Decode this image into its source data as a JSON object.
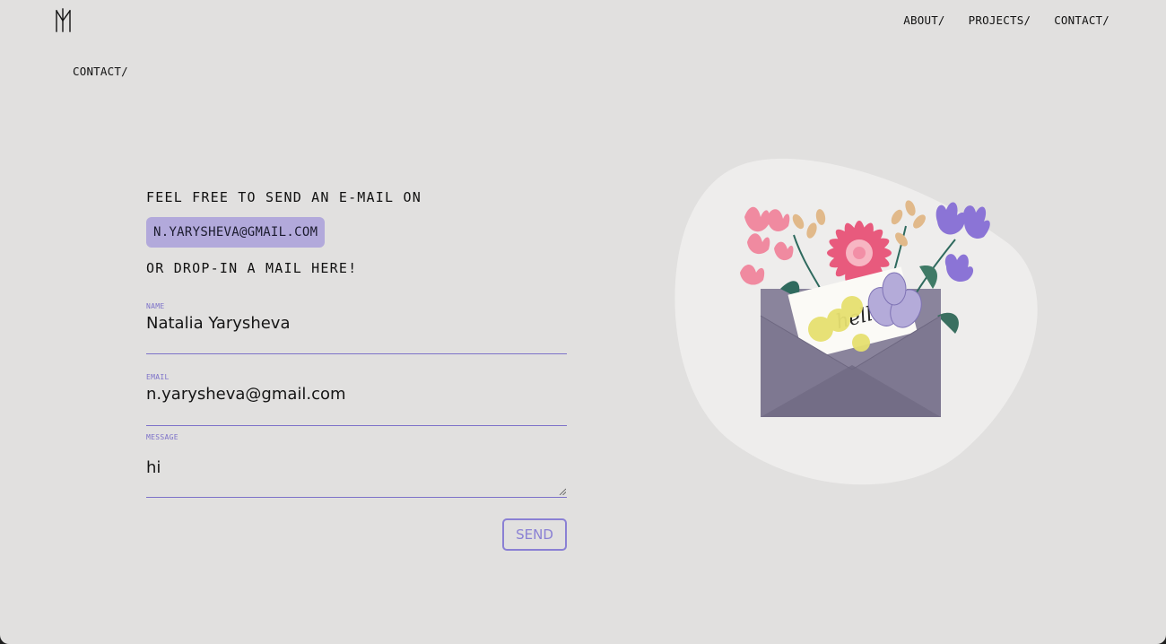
{
  "header": {
    "logo_icon": "monogram-n-logo-icon",
    "nav": [
      {
        "label": "ABOUT/"
      },
      {
        "label": "PROJECTS/"
      },
      {
        "label": "CONTACT/"
      }
    ]
  },
  "breadcrumb": "CONTACT/",
  "intro": {
    "line1": "FEEL FREE TO SEND AN E-MAIL ON",
    "email": "N.YARYSHEVA@GMAIL.COM",
    "line3": "OR DROP-IN A MAIL HERE!"
  },
  "form": {
    "name_label": "NAME",
    "name_value": "Natalia Yarysheva",
    "email_label": "EMAIL",
    "email_value": "n.yarysheva@gmail.com",
    "message_label": "MESSAGE",
    "message_value": "hi",
    "send_label": "SEND"
  },
  "illustration": {
    "icon": "envelope-with-flowers-illustration",
    "card_text": "hello"
  },
  "colors": {
    "background": "#e1e0df",
    "accent": "#7d72c9",
    "pill": "#b2a9db",
    "blob": "#eeedec",
    "envelope": "#7e7891"
  }
}
